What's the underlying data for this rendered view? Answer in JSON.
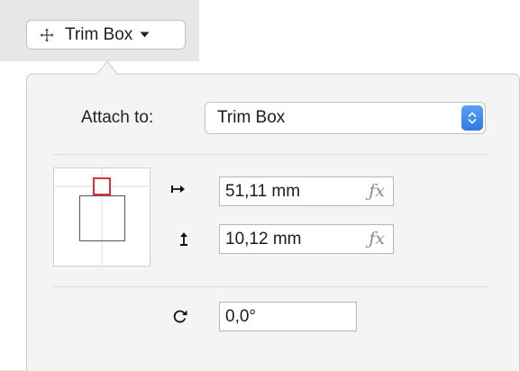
{
  "toolbar": {
    "trim_button_label": "Trim Box",
    "move_icon": "move-crosshair-icon",
    "dropdown_icon": "triangle-down-icon"
  },
  "attach": {
    "label": "Attach to:",
    "selected": "Trim Box",
    "stepper_icon": "select-stepper-icon"
  },
  "offset": {
    "horizontal": {
      "icon": "arrow-right-bar-icon",
      "value": "51,11 mm",
      "fx_label": "ƒx"
    },
    "vertical": {
      "icon": "arrow-up-bar-icon",
      "value": "10,12 mm",
      "fx_label": "ƒx"
    }
  },
  "rotation": {
    "icon": "rotate-clockwise-icon",
    "value": "0,0°"
  },
  "anchor": {
    "selected_point": "top-center"
  },
  "colors": {
    "accent_blue": "#3b86ef",
    "anchor_selected": "#e0323a",
    "toolbar_bg": "#e7e7e7",
    "popover_bg": "#f4f4f4"
  }
}
